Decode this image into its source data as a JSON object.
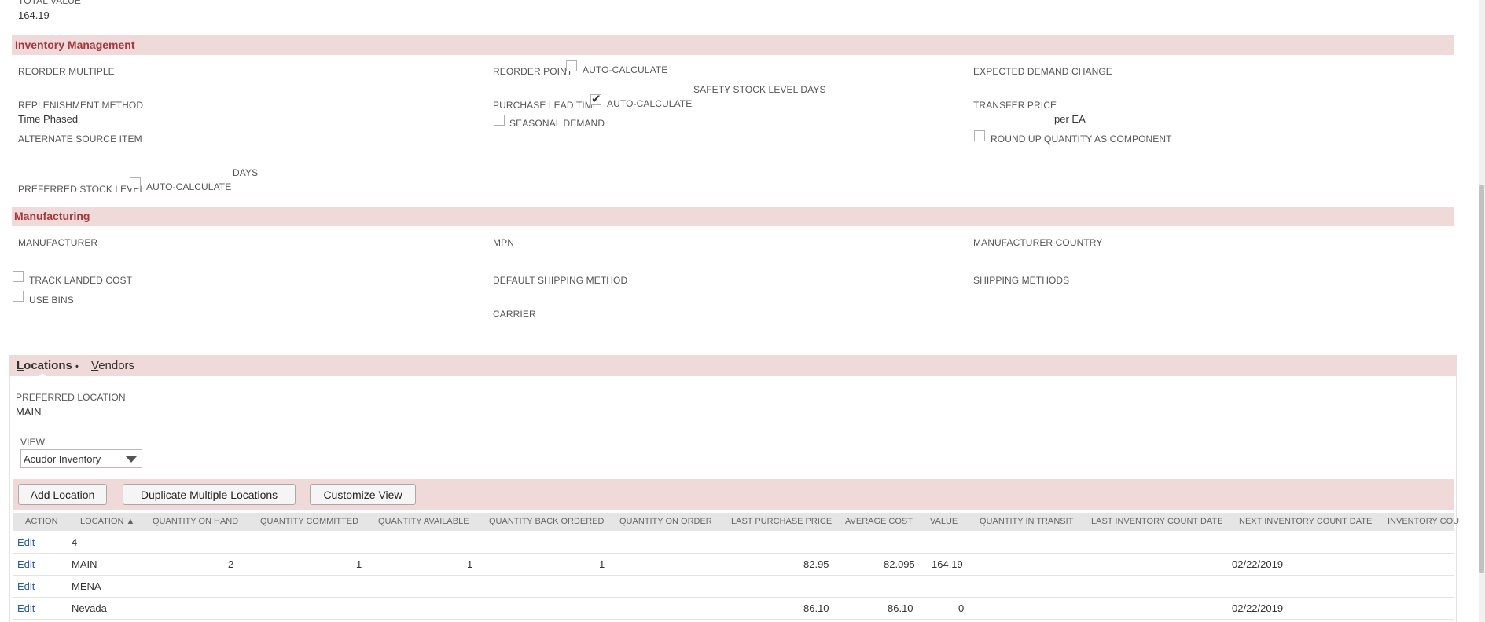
{
  "header": {
    "total_value_label": "TOTAL VALUE",
    "total_value": "164.19"
  },
  "inventory": {
    "title": "Inventory Management",
    "reorder_multiple": "REORDER MULTIPLE",
    "reorder_point": "REORDER POINT",
    "auto_calculate": "AUTO-CALCULATE",
    "expected_demand_change": "EXPECTED DEMAND CHANGE",
    "safety_stock_level_days": "SAFETY STOCK LEVEL DAYS",
    "replenishment_method": "REPLENISHMENT METHOD",
    "replenishment_value": "Time Phased",
    "purchase_lead_time": "PURCHASE LEAD TIME",
    "transfer_price": "TRANSFER PRICE",
    "per_ea": "per EA",
    "seasonal_demand": "SEASONAL DEMAND",
    "alternate_source_item": "ALTERNATE SOURCE ITEM",
    "round_up_quantity": "ROUND UP QUANTITY AS COMPONENT",
    "days": "DAYS",
    "preferred_stock_level": "PREFERRED STOCK LEVEL"
  },
  "manufacturing": {
    "title": "Manufacturing",
    "manufacturer": "MANUFACTURER",
    "mpn": "MPN",
    "manufacturer_country": "MANUFACTURER COUNTRY",
    "track_landed_cost": "TRACK LANDED COST",
    "default_shipping_method": "DEFAULT SHIPPING METHOD",
    "shipping_methods": "SHIPPING METHODS",
    "use_bins": "USE BINS",
    "carrier": "CARRIER"
  },
  "tabs": {
    "locations_first": "L",
    "locations_rest": "ocations",
    "locations_dot": "•",
    "vendors_first": "V",
    "vendors_rest": "endors"
  },
  "locations": {
    "preferred_location_label": "PREFERRED LOCATION",
    "preferred_location": "MAIN",
    "view_label": "VIEW",
    "view_value": "Acudor Inventory",
    "buttons": {
      "add_location": "Add Location",
      "duplicate": "Duplicate Multiple Locations",
      "customize": "Customize View"
    },
    "columns": {
      "action": "ACTION",
      "location": "LOCATION ▲",
      "qty_on_hand": "QUANTITY ON HAND",
      "qty_committed": "QUANTITY COMMITTED",
      "qty_available": "QUANTITY AVAILABLE",
      "qty_back_ordered": "QUANTITY BACK ORDERED",
      "qty_on_order": "QUANTITY ON ORDER",
      "last_purchase_price": "LAST PURCHASE PRICE",
      "average_cost": "AVERAGE COST",
      "value": "VALUE",
      "qty_in_transit": "QUANTITY IN TRANSIT",
      "last_count_date": "LAST INVENTORY COUNT DATE",
      "next_count_date": "NEXT INVENTORY COUNT DATE",
      "inventory_cou": "INVENTORY COU"
    },
    "rows": [
      {
        "action": "Edit",
        "location": "4",
        "on_hand": "",
        "committed": "",
        "available": "",
        "back_ordered": "",
        "last_price": "",
        "avg_cost": "",
        "value": "",
        "next_date": ""
      },
      {
        "action": "Edit",
        "location": "MAIN",
        "on_hand": "2",
        "committed": "1",
        "available": "1",
        "back_ordered": "1",
        "last_price": "82.95",
        "avg_cost": "82.095",
        "value": "164.19",
        "next_date": "02/22/2019"
      },
      {
        "action": "Edit",
        "location": "MENA",
        "on_hand": "",
        "committed": "",
        "available": "",
        "back_ordered": "",
        "last_price": "",
        "avg_cost": "",
        "value": "",
        "next_date": ""
      },
      {
        "action": "Edit",
        "location": "Nevada",
        "on_hand": "",
        "committed": "",
        "available": "",
        "back_ordered": "",
        "last_price": "86.10",
        "avg_cost": "86.10",
        "value": "0",
        "next_date": "02/22/2019"
      }
    ]
  }
}
